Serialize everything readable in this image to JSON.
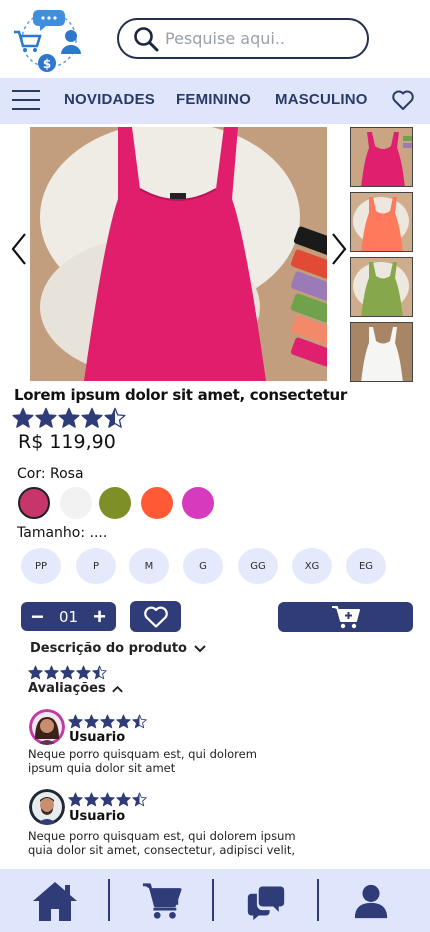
{
  "header": {
    "search_placeholder": "Pesquise aqui.."
  },
  "nav": {
    "links": [
      "NOVIDADES",
      "FEMININO",
      "MASCULINO"
    ]
  },
  "product": {
    "title": "Lorem ipsum dolor sit amet, consectetur",
    "rating": 4.5,
    "price": "R$ 119,90",
    "color_label": "Cor: Rosa",
    "colors": [
      "#c7366a",
      "#f2f2f2",
      "#7e8f27",
      "#ff5a36",
      "#d63bbd"
    ],
    "size_label": "Tamanho: ....",
    "sizes": [
      "PP",
      "P",
      "M",
      "G",
      "GG",
      "XG",
      "EG"
    ],
    "quantity": "01",
    "description_label": "Descrição do produto",
    "reviews_label": "Avaliações",
    "main_image_color": "#e01e6b",
    "thumb_colors": [
      "#e0206e",
      "#ff7a5c",
      "#86a84a",
      "#f3f3f3"
    ]
  },
  "reviews": [
    {
      "user": "Usuario",
      "rating": 4.5,
      "lines": [
        "Neque porro quisquam est, qui dolorem",
        "ipsum quia dolor sit amet"
      ]
    },
    {
      "user": "Usuario",
      "rating": 4.5,
      "lines": [
        "Neque porro quisquam est, qui dolorem ipsum",
        "quia dolor sit amet, consectetur, adipisci velit,"
      ]
    }
  ],
  "colors": {
    "primary": "#2f3c78",
    "nav_bg": "#dfe5fb"
  },
  "bottom_nav": [
    "home-icon",
    "cart-icon",
    "chat-icon",
    "user-icon"
  ]
}
